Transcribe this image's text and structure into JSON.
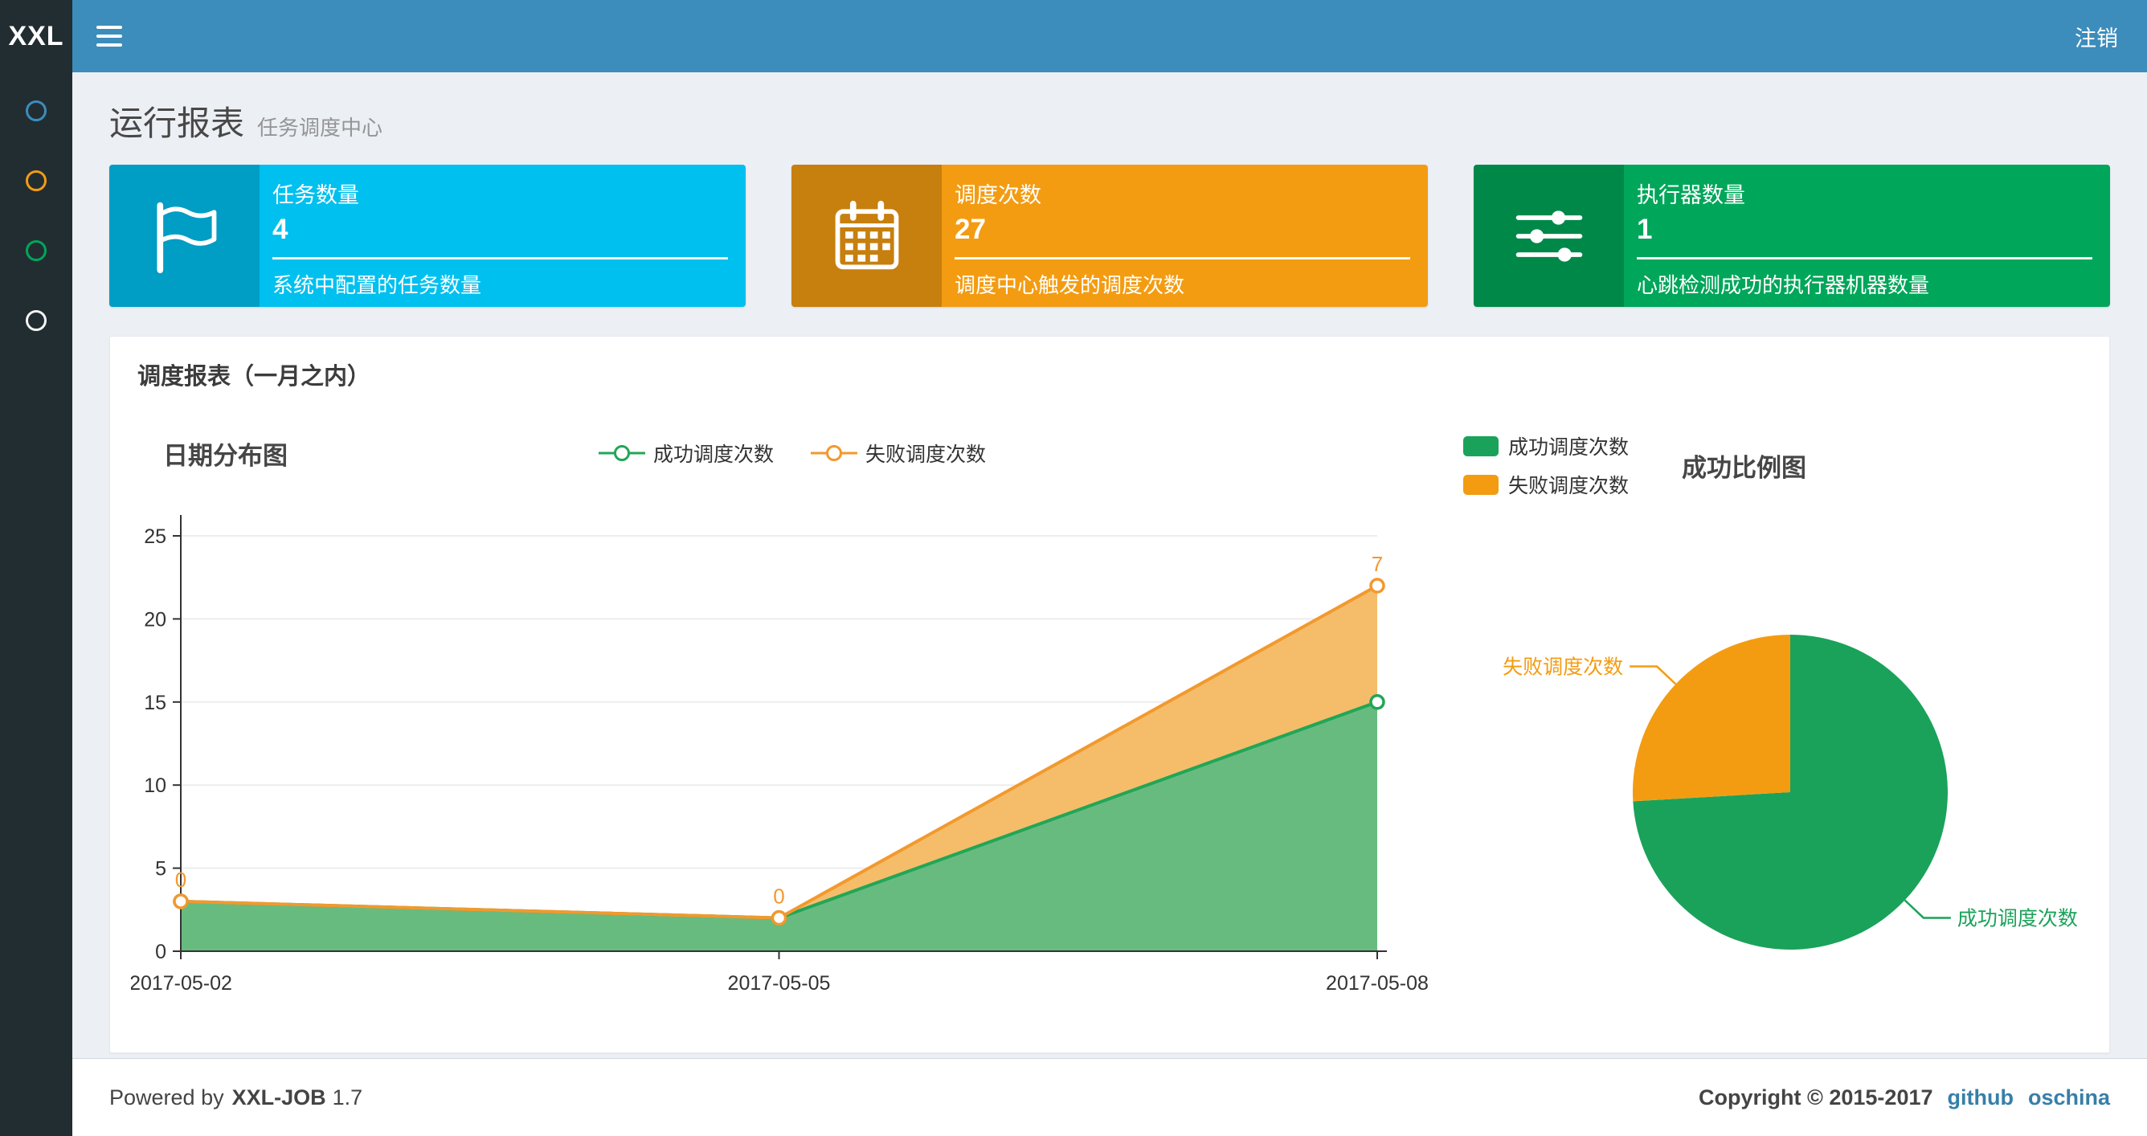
{
  "navbar": {
    "logo": "XXL",
    "logout": "注销"
  },
  "sidebar": {
    "items": [
      {
        "icon": "circle-icon",
        "color": "#3c8dbc"
      },
      {
        "icon": "circle-icon",
        "color": "#f39c12"
      },
      {
        "icon": "circle-icon",
        "color": "#00a65a"
      },
      {
        "icon": "circle-icon",
        "color": "#f5f5f5"
      }
    ]
  },
  "page_header": {
    "title": "运行报表",
    "subtitle": "任务调度中心"
  },
  "info_boxes": [
    {
      "icon": "flag-icon",
      "label": "任务数量",
      "value": "4",
      "desc": "系统中配置的任务数量",
      "bg": "#00c0ef"
    },
    {
      "icon": "calendar-icon",
      "label": "调度次数",
      "value": "27",
      "desc": "调度中心触发的调度次数",
      "bg": "#f39c12"
    },
    {
      "icon": "sliders-icon",
      "label": "执行器数量",
      "value": "1",
      "desc": "心跳检测成功的执行器机器数量",
      "bg": "#00a65a"
    }
  ],
  "panel": {
    "title": "调度报表（一月之内）"
  },
  "chart_data": [
    {
      "type": "area",
      "title": "日期分布图",
      "x": [
        "2017-05-02",
        "2017-05-05",
        "2017-05-08"
      ],
      "stacked": true,
      "series": [
        {
          "name": "成功调度次数",
          "values": [
            3,
            2,
            15
          ],
          "color": "#21a658",
          "fill": "#68bb7e"
        },
        {
          "name": "失败调度次数",
          "values": [
            0,
            0,
            7
          ],
          "color": "#f2992e",
          "fill": "#f5bd6a",
          "labels": [
            "0",
            "0",
            "7"
          ]
        }
      ],
      "ylim": [
        0,
        25
      ],
      "yticks": [
        0,
        5,
        10,
        15,
        20,
        25
      ],
      "legend_position": "top-center",
      "grid": true
    },
    {
      "type": "pie",
      "title": "成功比例图",
      "slices": [
        {
          "name": "成功调度次数",
          "value": 20,
          "color": "#1aa25a"
        },
        {
          "name": "失败调度次数",
          "value": 7,
          "color": "#f39c12"
        }
      ],
      "legend_position": "top-left"
    }
  ],
  "footer": {
    "powered_by": "Powered by",
    "product": "XXL-JOB",
    "version": "1.7",
    "copyright": "Copyright © 2015-2017",
    "links": [
      "github",
      "oschina"
    ]
  },
  "theme": {
    "navbar_bg": "#3c8dbc",
    "sidebar_bg": "#222d32",
    "content_bg": "#ecf0f5",
    "aqua": "#00c0ef",
    "yellow": "#f39c12",
    "green": "#00a65a",
    "link": "#367fa9"
  }
}
